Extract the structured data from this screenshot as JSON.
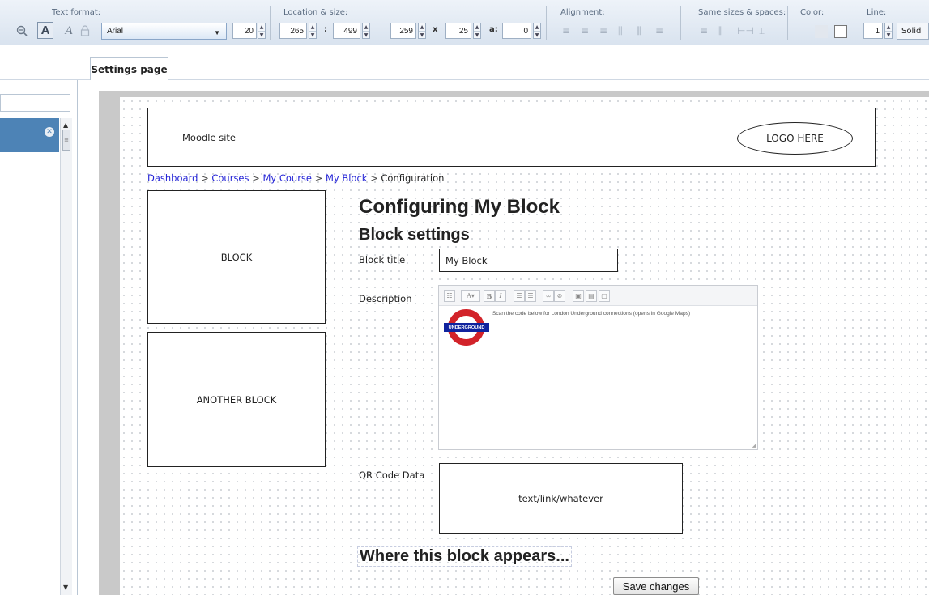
{
  "toolbar": {
    "groups": {
      "text_format": "Text format:",
      "location_size": "Location & size:",
      "alignment": "Alignment:",
      "same_sizes": "Same sizes & spaces:",
      "color": "Color:",
      "line": "Line:"
    },
    "font": "Arial",
    "font_size": "20",
    "x": "265",
    "y": "499",
    "width": "259",
    "height": "25",
    "angle": "0",
    "size_separator": "x",
    "angle_label": "a:",
    "coord_separator": ":",
    "line_width": "1",
    "line_style": "Solid",
    "icons": {
      "zoom_out": "zoom-out-icon",
      "bold_text": "text-bold-icon",
      "italic_text": "text-italic-icon",
      "lock": "lock-icon",
      "align": "align-icon",
      "same_size": "same-size-icon",
      "line_color": "line-color-icon"
    }
  },
  "tabs": {
    "active": "Settings page"
  },
  "left_panel": {
    "close_glyph": "✕"
  },
  "mockup": {
    "site_name": "Moodle site",
    "logo_text": "LOGO HERE",
    "breadcrumb": {
      "items": [
        "Dashboard",
        "Courses",
        "My Course",
        "My Block"
      ],
      "current": "Configuration",
      "separator": ">"
    },
    "blocks": [
      "BLOCK",
      "ANOTHER BLOCK"
    ],
    "page_heading": "Configuring My Block",
    "section_heading": "Block settings",
    "fields": {
      "block_title_label": "Block title",
      "block_title_value": "My Block",
      "description_label": "Description",
      "description_text": "Scan the code below for London Underground connections (opens in Google Maps)",
      "underground_label": "UNDERGROUND",
      "qr_label": "QR Code Data",
      "qr_value": "text/link/whatever"
    },
    "where_heading": "Where this block appears...",
    "save_button": "Save changes"
  },
  "colors": {
    "link": "#2323d6",
    "selection": "#4d83b6",
    "underground_red": "#d2232a",
    "underground_blue": "#10239e"
  }
}
